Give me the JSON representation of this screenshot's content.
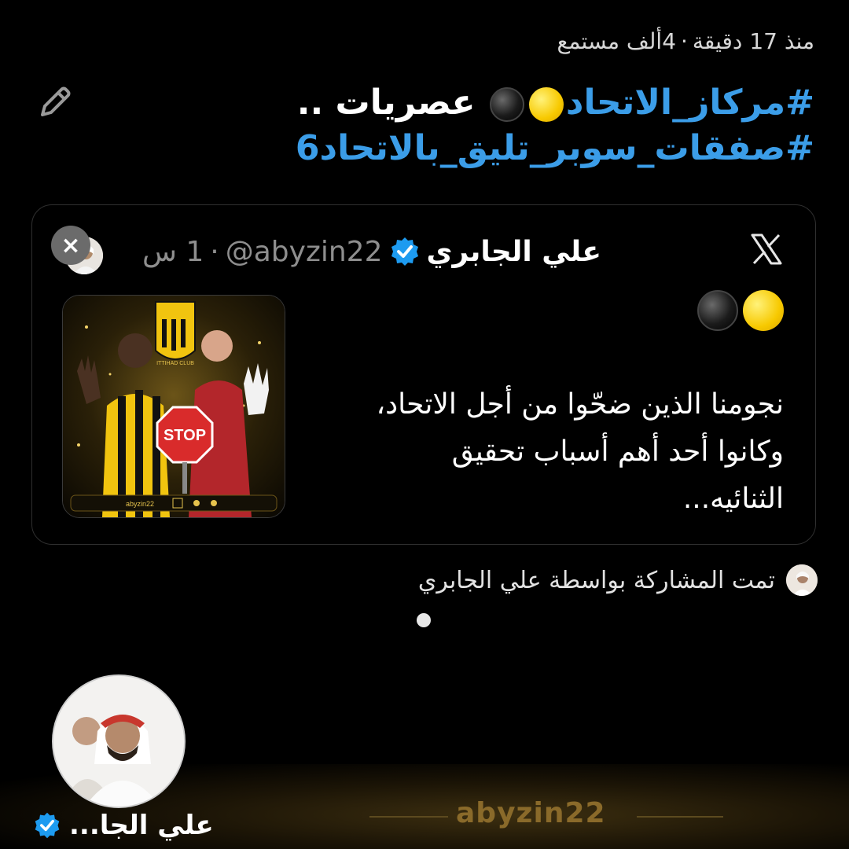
{
  "meta": {
    "time_ago": "منذ 17 دقيقة",
    "separator": "·",
    "listeners": "4ألف مستمع"
  },
  "headline": {
    "tag1": "#مركاز_الاتحاد",
    "word": "عصريات ..",
    "tag2": "#صفقات_سوبر_تليق_بالاتحاد6"
  },
  "card": {
    "author_name": "علي الجابري",
    "handle": "@abyzin22",
    "dot": "·",
    "time": "1 س",
    "close_label": "×",
    "text_lines": [
      "نجومنا الذين ضحّوا من أجل الاتحاد،",
      "وكانوا أحد أهم أسباب تحقيق",
      "الثنائيه..."
    ],
    "image": {
      "stop_sign": "STOP",
      "club_text": "ITTIHAD CLUB",
      "footer_handle": "abyzin22"
    }
  },
  "shared": {
    "text": "تمت المشاركة بواسطة علي الجابري"
  },
  "bottom": {
    "name": "علي الجا...",
    "watermark": "abyzin22"
  },
  "colors": {
    "hashtag": "#3b9de8",
    "verified": "#1d9bf0",
    "accent_gold": "#8a6a2a",
    "background": "#000000"
  },
  "icons": [
    "pencil-icon",
    "x-logo-icon",
    "verified-badge-icon",
    "close-icon",
    "yellow-circle-emoji",
    "black-circle-emoji"
  ]
}
